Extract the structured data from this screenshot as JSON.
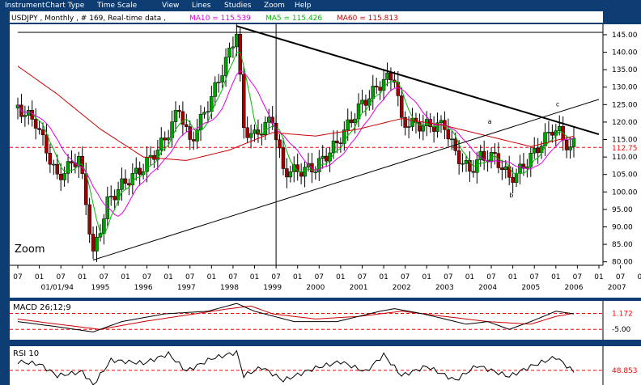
{
  "menu": [
    "Instrument",
    "Chart Type",
    "Time Scale",
    "View",
    "Lines",
    "Studies",
    "Zoom",
    "Help"
  ],
  "header": {
    "symbol_text": "USDJPY , Monthly , # 169, Real-time data ,",
    "ma10_text": "MA10 = 115.539",
    "ma5_text": "MA5 = 115.426",
    "ma60_text": "MA60 = 115.813"
  },
  "colors": {
    "bg": "#0d3d73",
    "panel": "#ffffff",
    "up": "#00a000",
    "down": "#a00000",
    "ma5": "#00bb00",
    "ma10": "#e000e0",
    "ma60": "#cc0000",
    "ref": "#ff0000"
  },
  "zoom_label": "Zoom",
  "annotations": [
    "a",
    "b",
    "c"
  ],
  "chart_data": [
    {
      "type": "candlestick",
      "title": "USDJPY , Monthly",
      "ylim": [
        79,
        148
      ],
      "y_ticks": [
        "145.00",
        "140.00",
        "135.00",
        "130.00",
        "125.00",
        "120.00",
        "115.00",
        "110.00",
        "105.00",
        "100.00",
        "95.00",
        "90.00",
        "85.00",
        "80.00"
      ],
      "current_value_label": "112.75",
      "current_value": 112.75,
      "x_months": [
        "07",
        "01",
        "07",
        "01",
        "07",
        "01",
        "07",
        "01",
        "07",
        "01",
        "07",
        "01",
        "07",
        "01",
        "07",
        "01",
        "07",
        "01",
        "07",
        "01",
        "07",
        "01",
        "07",
        "01",
        "07",
        "01",
        "07",
        "01",
        "07",
        "01"
      ],
      "x_years": [
        "01/01/94",
        "1995",
        "1996",
        "1997",
        "1998",
        "1999",
        "2000",
        "2001",
        "2002",
        "2003",
        "2004",
        "2005",
        "2006",
        "2007"
      ],
      "start": "1993-07",
      "end": "2007-01",
      "close_path": [
        [
          "1993-07",
          124
        ],
        [
          "1993-12",
          120
        ],
        [
          "1994-06",
          104
        ],
        [
          "1994-12",
          110
        ],
        [
          "1995-02",
          97
        ],
        [
          "1995-04",
          82
        ],
        [
          "1995-08",
          97
        ],
        [
          "1995-12",
          102
        ],
        [
          "1996-06",
          107
        ],
        [
          "1996-12",
          115
        ],
        [
          "1997-04",
          124
        ],
        [
          "1997-07",
          114
        ],
        [
          "1998-01",
          127
        ],
        [
          "1998-06",
          140
        ],
        [
          "1998-08",
          146
        ],
        [
          "1998-10",
          118
        ],
        [
          "1999-01",
          116
        ],
        [
          "1999-06",
          121
        ],
        [
          "1999-09",
          106
        ],
        [
          "2000-01",
          106
        ],
        [
          "2000-06",
          107
        ],
        [
          "2000-12",
          114
        ],
        [
          "2001-06",
          124
        ],
        [
          "2002-01",
          132
        ],
        [
          "2002-04",
          133
        ],
        [
          "2002-06",
          120
        ],
        [
          "2002-12",
          119
        ],
        [
          "2003-06",
          119
        ],
        [
          "2003-09",
          111
        ],
        [
          "2004-01",
          106
        ],
        [
          "2004-04",
          110
        ],
        [
          "2004-08",
          110
        ],
        [
          "2004-12",
          104
        ],
        [
          "2005-02",
          105
        ],
        [
          "2005-06",
          110
        ],
        [
          "2005-12",
          118
        ],
        [
          "2006-02",
          117
        ],
        [
          "2006-05",
          112
        ],
        [
          "2006-06",
          114
        ]
      ],
      "ma60_path": [
        [
          "1993-07",
          136
        ],
        [
          "1994-06",
          128
        ],
        [
          "1995-06",
          118
        ],
        [
          "1996-06",
          110
        ],
        [
          "1997-06",
          109
        ],
        [
          "1998-06",
          112
        ],
        [
          "1999-06",
          117
        ],
        [
          "2000-06",
          116
        ],
        [
          "2001-06",
          118
        ],
        [
          "2002-06",
          121
        ],
        [
          "2003-06",
          119
        ],
        [
          "2004-06",
          116
        ],
        [
          "2005-06",
          113
        ],
        [
          "2006-06",
          116
        ]
      ],
      "trendlines": [
        {
          "from": [
            "1998-08",
            147.5
          ],
          "to": [
            "2007-01",
            116.5
          ]
        },
        {
          "from": [
            "1995-04",
            80.5
          ],
          "to": [
            "2007-01",
            126.5
          ]
        }
      ],
      "vertical_marker": "1999-07"
    },
    {
      "type": "line",
      "title": "MACD 26;12;9",
      "ylim": [
        -9,
        6
      ],
      "labels": [
        "1.172",
        "-5.00"
      ],
      "label_values": [
        1.172,
        -5
      ],
      "reference_lines": [
        1.172,
        -5
      ],
      "macd_path": [
        [
          "1993-07",
          -2
        ],
        [
          "1994-06",
          -4
        ],
        [
          "1995-04",
          -6
        ],
        [
          "1995-12",
          -2
        ],
        [
          "1996-12",
          1
        ],
        [
          "1997-12",
          2
        ],
        [
          "1998-08",
          5
        ],
        [
          "1999-01",
          2
        ],
        [
          "1999-12",
          -2
        ],
        [
          "2000-12",
          -2
        ],
        [
          "2001-12",
          2
        ],
        [
          "2002-04",
          3
        ],
        [
          "2002-12",
          1
        ],
        [
          "2003-12",
          -3
        ],
        [
          "2004-06",
          -2
        ],
        [
          "2004-12",
          -5
        ],
        [
          "2005-06",
          -2
        ],
        [
          "2006-01",
          2
        ],
        [
          "2006-06",
          1
        ]
      ],
      "signal_path": [
        [
          "1993-07",
          -1
        ],
        [
          "1994-06",
          -3
        ],
        [
          "1995-06",
          -5
        ],
        [
          "1996-06",
          -2
        ],
        [
          "1997-06",
          0.5
        ],
        [
          "1998-06",
          3
        ],
        [
          "1998-12",
          4
        ],
        [
          "1999-06",
          1
        ],
        [
          "2000-06",
          -1
        ],
        [
          "2001-06",
          0
        ],
        [
          "2002-06",
          2
        ],
        [
          "2003-06",
          0
        ],
        [
          "2004-06",
          -2
        ],
        [
          "2005-06",
          -3
        ],
        [
          "2006-01",
          0
        ],
        [
          "2006-06",
          1.2
        ]
      ]
    },
    {
      "type": "line",
      "title": "RSI 10",
      "ylim": [
        30,
        80
      ],
      "labels": [
        "48.853"
      ],
      "label_values": [
        48.853
      ],
      "reference_lines": [
        48.853
      ],
      "rsi_path": [
        [
          "1993-07",
          60
        ],
        [
          "1994-01",
          57
        ],
        [
          "1994-06",
          42
        ],
        [
          "1995-01",
          47
        ],
        [
          "1995-04",
          30
        ],
        [
          "1995-09",
          62
        ],
        [
          "1996-06",
          58
        ],
        [
          "1997-01",
          70
        ],
        [
          "1997-06",
          48
        ],
        [
          "1998-01",
          64
        ],
        [
          "1998-08",
          72
        ],
        [
          "1998-10",
          42
        ],
        [
          "1999-03",
          53
        ],
        [
          "1999-09",
          36
        ],
        [
          "2000-06",
          52
        ],
        [
          "2001-01",
          60
        ],
        [
          "2001-08",
          47
        ],
        [
          "2002-01",
          69
        ],
        [
          "2002-06",
          42
        ],
        [
          "2003-01",
          54
        ],
        [
          "2003-09",
          36
        ],
        [
          "2004-03",
          55
        ],
        [
          "2004-12",
          41
        ],
        [
          "2005-06",
          54
        ],
        [
          "2006-01",
          66
        ],
        [
          "2006-06",
          47
        ]
      ]
    }
  ]
}
